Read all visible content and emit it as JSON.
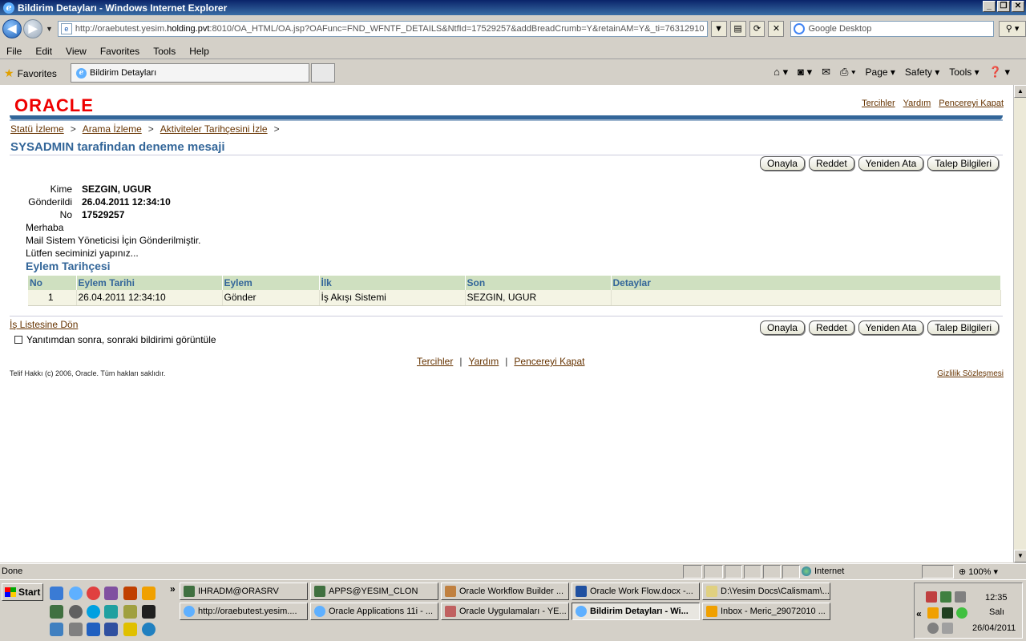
{
  "window": {
    "title": "Bildirim Detayları - Windows Internet Explorer",
    "min": "_",
    "max": "❐",
    "close": "✕"
  },
  "address": {
    "url_prefix": "http://oraebutest.yesim.",
    "url_host": "holding.pvt",
    "url_suffix": ":8010/OA_HTML/OA.jsp?OAFunc=FND_WFNTF_DETAILS&NtfId=17529257&addBreadCrumb=Y&retainAM=Y&_ti=76312910",
    "search_placeholder": "Google Desktop"
  },
  "menu": [
    "File",
    "Edit",
    "View",
    "Favorites",
    "Tools",
    "Help"
  ],
  "favorites": {
    "label": "Favorites",
    "tab_title": "Bildirim Detayları"
  },
  "cmdbar": {
    "page": "Page",
    "safety": "Safety",
    "tools": "Tools"
  },
  "page": {
    "logo": "ORACLE",
    "toplinks": [
      "Tercihler",
      "Yardım",
      "Pencereyi Kapat"
    ],
    "breadcrumb": [
      "Statü İzleme",
      "Arama İzleme",
      "Aktiviteler Tarihçesini İzle"
    ],
    "breadcrumb_sep": ">",
    "title": "SYSADMIN tarafindan deneme mesaji",
    "buttons": [
      "Onayla",
      "Reddet",
      "Yeniden Ata",
      "Talep Bilgileri"
    ],
    "fields": {
      "to_label": "Kime",
      "to_value": "SEZGIN, UGUR",
      "sent_label": "Gönderildi",
      "sent_value": "26.04.2011 12:34:10",
      "no_label": "No",
      "no_value": "17529257"
    },
    "message": [
      "Merhaba",
      "Mail Sistem Yöneticisi İçin Gönderilmiştir.",
      "Lütfen seciminizi yapınız..."
    ],
    "history_title": "Eylem Tarihçesi",
    "history_columns": [
      "No",
      "Eylem Tarihi",
      "Eylem",
      "İlk",
      "Son",
      "Detaylar"
    ],
    "history_rows": [
      [
        "1",
        "26.04.2011 12:34:10",
        "Gönder",
        "İş Akışı Sistemi",
        "SEZGIN, UGUR",
        ""
      ]
    ],
    "return_link": "İş Listesine Dön",
    "next_checkbox": "Yanıtımdan sonra, sonraki bildirimi görüntüle",
    "footer_links": [
      "Tercihler",
      "Yardım",
      "Pencereyi Kapat"
    ],
    "footer_sep": "|",
    "copyright": "Telif Hakkı (c) 2006, Oracle. Tüm hakları saklıdır.",
    "privacy": "Gizlilik Sözleşmesi"
  },
  "status": {
    "text": "Done",
    "zone": "Internet",
    "zoom": "100%"
  },
  "taskbar": {
    "start": "Start",
    "row1": [
      "IHRADM@ORASRV",
      "APPS@YESIM_CLON",
      "Oracle Workflow Builder ...",
      "Oracle Work Flow.docx -...",
      "D:\\Yesim Docs\\Calismam\\..."
    ],
    "row2": [
      "http://oraebutest.yesim....",
      "Oracle Applications 11i - ...",
      "Oracle Uygulamaları - YE...",
      "Bildirim Detayları - Wi...",
      "Inbox - Meric_29072010 ..."
    ],
    "clock": {
      "time": "12:35",
      "day": "Salı",
      "date": "26/04/2011"
    }
  }
}
